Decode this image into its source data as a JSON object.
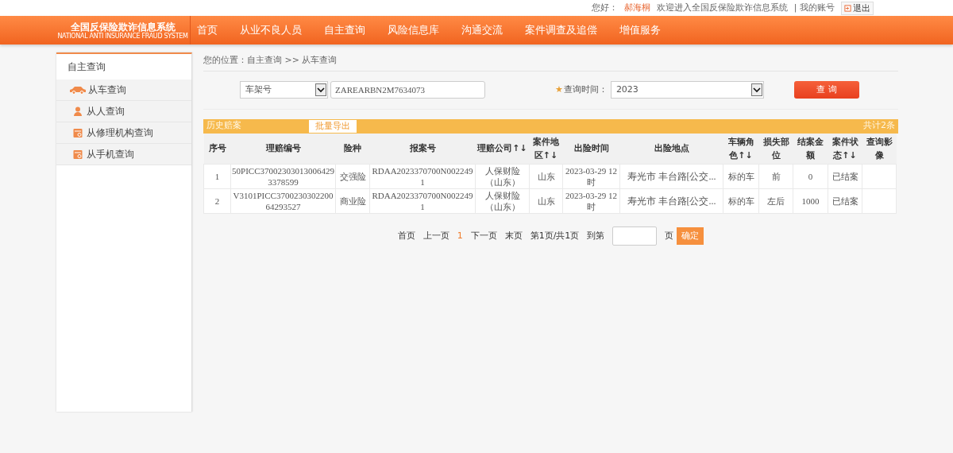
{
  "top_bar": {
    "greeting": "您好：",
    "user": "郝海桐",
    "welcome": "欢迎进入全国反保险欺诈信息系统",
    "account": "| 我的账号",
    "logout": "退出"
  },
  "logo": {
    "title": "全国反保险欺诈信息系统",
    "subtitle": "NATIONAL ANTI INSURANCE FRAUD SYSTEM"
  },
  "nav": [
    "首页",
    "从业不良人员",
    "自主查询",
    "风险信息库",
    "沟通交流",
    "案件调查及追偿",
    "增值服务"
  ],
  "sidebar": {
    "title": "自主查询",
    "items": [
      {
        "label": "从车查询",
        "kind": "car"
      },
      {
        "label": "从人查询",
        "kind": "person"
      },
      {
        "label": "从修理机构查询",
        "kind": "calendar"
      },
      {
        "label": "从手机查询",
        "kind": "calendar"
      }
    ]
  },
  "breadcrumb": "您的位置：自主查询 >> 从车查询",
  "search": {
    "type_select": "车架号",
    "value": "ZAREARBN2M7634073",
    "required_mark": "★",
    "time_label": "查询时间：",
    "time_select": "2023",
    "button": "查 询"
  },
  "history": {
    "title": "历史赔案",
    "export_button": "批量导出",
    "total": "共计2条"
  },
  "table": {
    "columns": [
      "序号",
      "理赔编号",
      "险种",
      "报案号",
      "理赔公司↑↓",
      "案件地区↑↓",
      "出险时间",
      "出险地点",
      "车辆角色↑↓",
      "损失部位",
      "结案金额",
      "案件状态↑↓",
      "查询影像"
    ],
    "rows": [
      [
        "1",
        "50PICC370023030130064293378599",
        "交强险",
        "RDAA2023370700N0022491",
        "人保财险（山东）",
        "山东",
        "2023-03-29 12时",
        "寿光市 丰台路[公交...",
        "标的车",
        "前",
        "0",
        "已结案",
        ""
      ],
      [
        "2",
        "V3101PICC370023030220064293527",
        "商业险",
        "RDAA2023370700N0022491",
        "人保财险（山东）",
        "山东",
        "2023-03-29 12时",
        "寿光市 丰台路[公交...",
        "标的车",
        "左后",
        "1000",
        "已结案",
        ""
      ]
    ]
  },
  "pagination": {
    "first": "首页",
    "prev": "上一页",
    "pages": [
      {
        "label": "1",
        "selected": true
      }
    ],
    "next": "下一页",
    "last": "末页",
    "info": "第1页/共1页",
    "goto_label": "到第",
    "goto_suffix": "页",
    "confirm": "确定"
  }
}
